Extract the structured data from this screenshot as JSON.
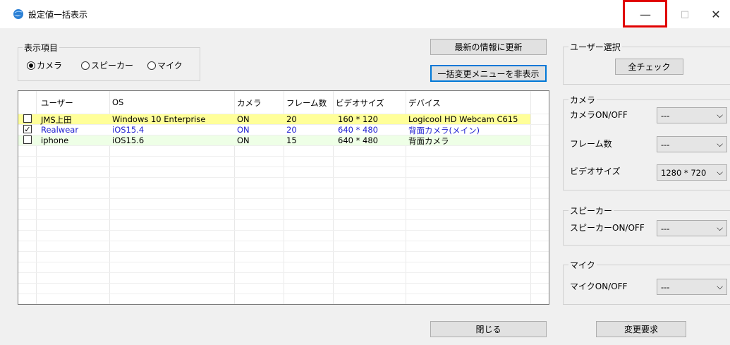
{
  "window": {
    "title": "設定値一括表示",
    "minimize_glyph": "—",
    "maximize_glyph": "□",
    "close_glyph": "✕"
  },
  "display_items": {
    "legend": "表示項目",
    "options": [
      {
        "label": "カメラ",
        "selected": true
      },
      {
        "label": "スピーカー",
        "selected": false
      },
      {
        "label": "マイク",
        "selected": false
      }
    ]
  },
  "buttons": {
    "refresh": "最新の情報に更新",
    "hide_bulk_menu": "一括変更メニューを非表示",
    "close": "閉じる",
    "request_change": "変更要求",
    "check_all": "全チェック"
  },
  "table": {
    "columns": [
      "ユーザー",
      "OS",
      "カメラ",
      "フレーム数",
      "ビデオサイズ",
      "デバイス"
    ],
    "rows": [
      {
        "checked": false,
        "user": "JMS上田",
        "os": "Windows 10 Enterprise",
        "camera": "ON",
        "frames": "20",
        "video_size": "160 * 120",
        "device": "Logicool HD Webcam C615",
        "bg": "#ffff99",
        "color": "#000000"
      },
      {
        "checked": true,
        "user": "Realwear",
        "os": "iOS15.4",
        "camera": "ON",
        "frames": "20",
        "video_size": "640 * 480",
        "device": "背面カメラ(メイン)",
        "bg": "#ffffff",
        "color": "#1f1fd0"
      },
      {
        "checked": false,
        "user": "iphone",
        "os": "iOS15.6",
        "camera": "ON",
        "frames": "15",
        "video_size": "640 * 480",
        "device": "背面カメラ",
        "bg": "#eeffe6",
        "color": "#000000"
      }
    ],
    "check_glyph": "✓"
  },
  "side": {
    "user_select": {
      "legend": "ユーザー選択"
    },
    "camera": {
      "legend": "カメラ",
      "onoff_label": "カメラON/OFF",
      "onoff_value": "---",
      "frames_label": "フレーム数",
      "frames_value": "---",
      "video_label": "ビデオサイズ",
      "video_value": "1280 * 720"
    },
    "speaker": {
      "legend": "スピーカー",
      "onoff_label": "スピーカーON/OFF",
      "onoff_value": "---"
    },
    "mic": {
      "legend": "マイク",
      "onoff_label": "マイクON/OFF",
      "onoff_value": "---"
    },
    "chevron_glyph": "⌵"
  }
}
